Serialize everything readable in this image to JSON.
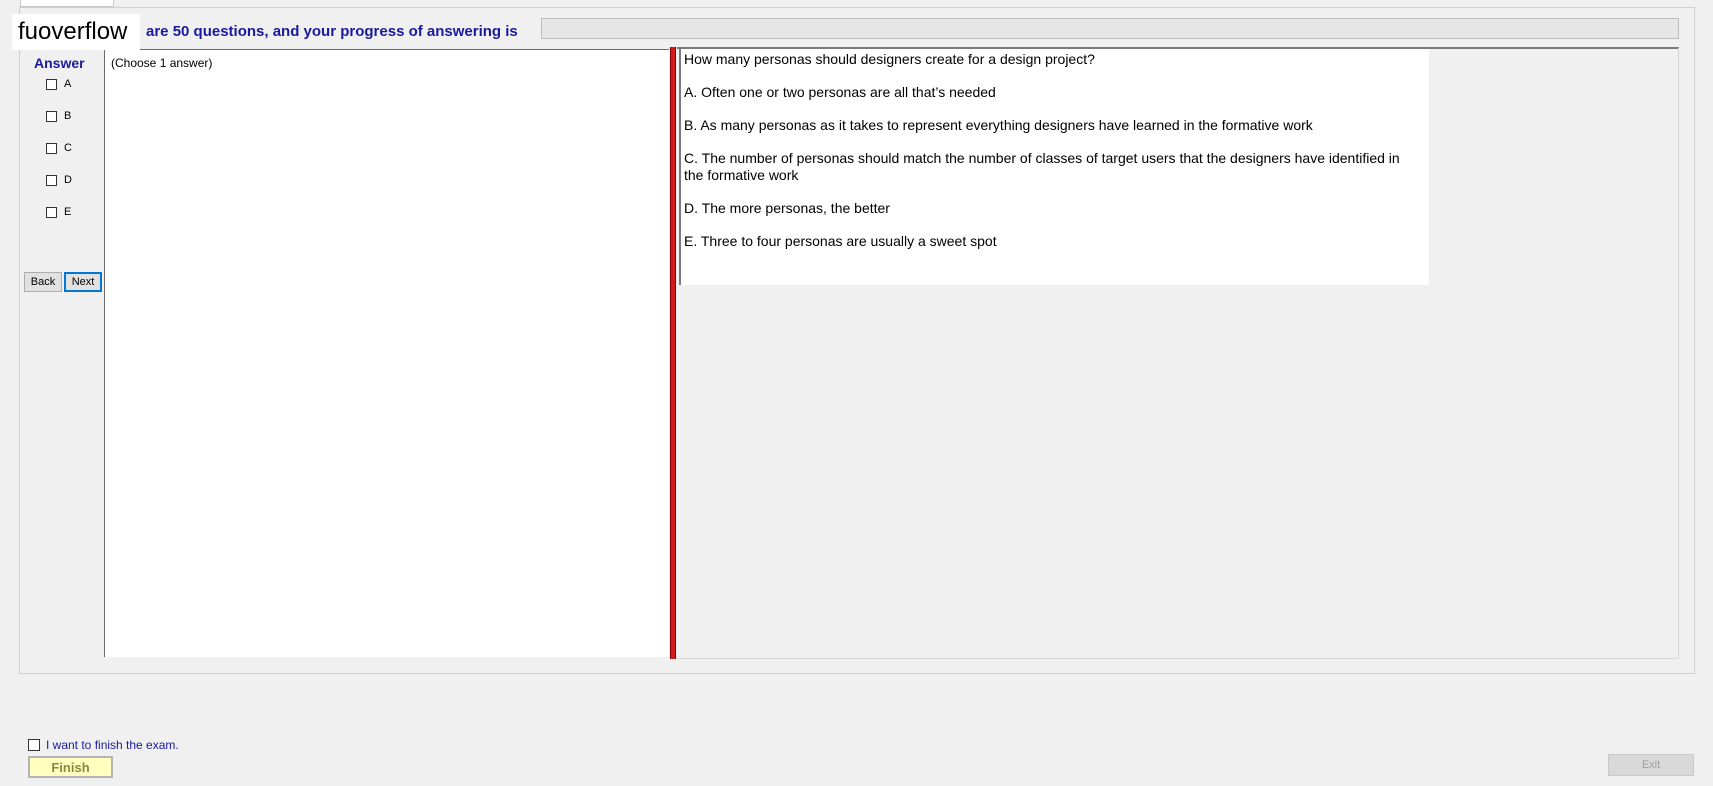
{
  "header": {
    "logo_text": "fuoverflow",
    "progress_label": "are 50 questions, and your progress of answering is",
    "progress_value": 0
  },
  "answer_panel": {
    "title": "Answer",
    "options": [
      "A",
      "B",
      "C",
      "D",
      "E"
    ],
    "back_label": "Back",
    "next_label": "Next"
  },
  "left_pane": {
    "instruction": "(Choose 1 answer)"
  },
  "question": {
    "text": "How many personas should designers create for a design project?",
    "choices": [
      "A.  Often one or two personas are all that’s needed",
      "B.  As many personas as it takes to represent everything designers have learned in the formative work",
      "C.  The number of personas should match the number of classes of target users that the designers have identified in the formative work",
      "D.  The more personas, the better",
      "E.  Three to four personas are usually a sweet spot"
    ]
  },
  "footer": {
    "finish_check_label": "I want to finish the exam.",
    "finish_label": "Finish",
    "exit_label": "Exit"
  },
  "colors": {
    "accent_text": "#1a1a9e",
    "splitter": "#d21a1a",
    "finish_bg": "#ffffc0"
  }
}
